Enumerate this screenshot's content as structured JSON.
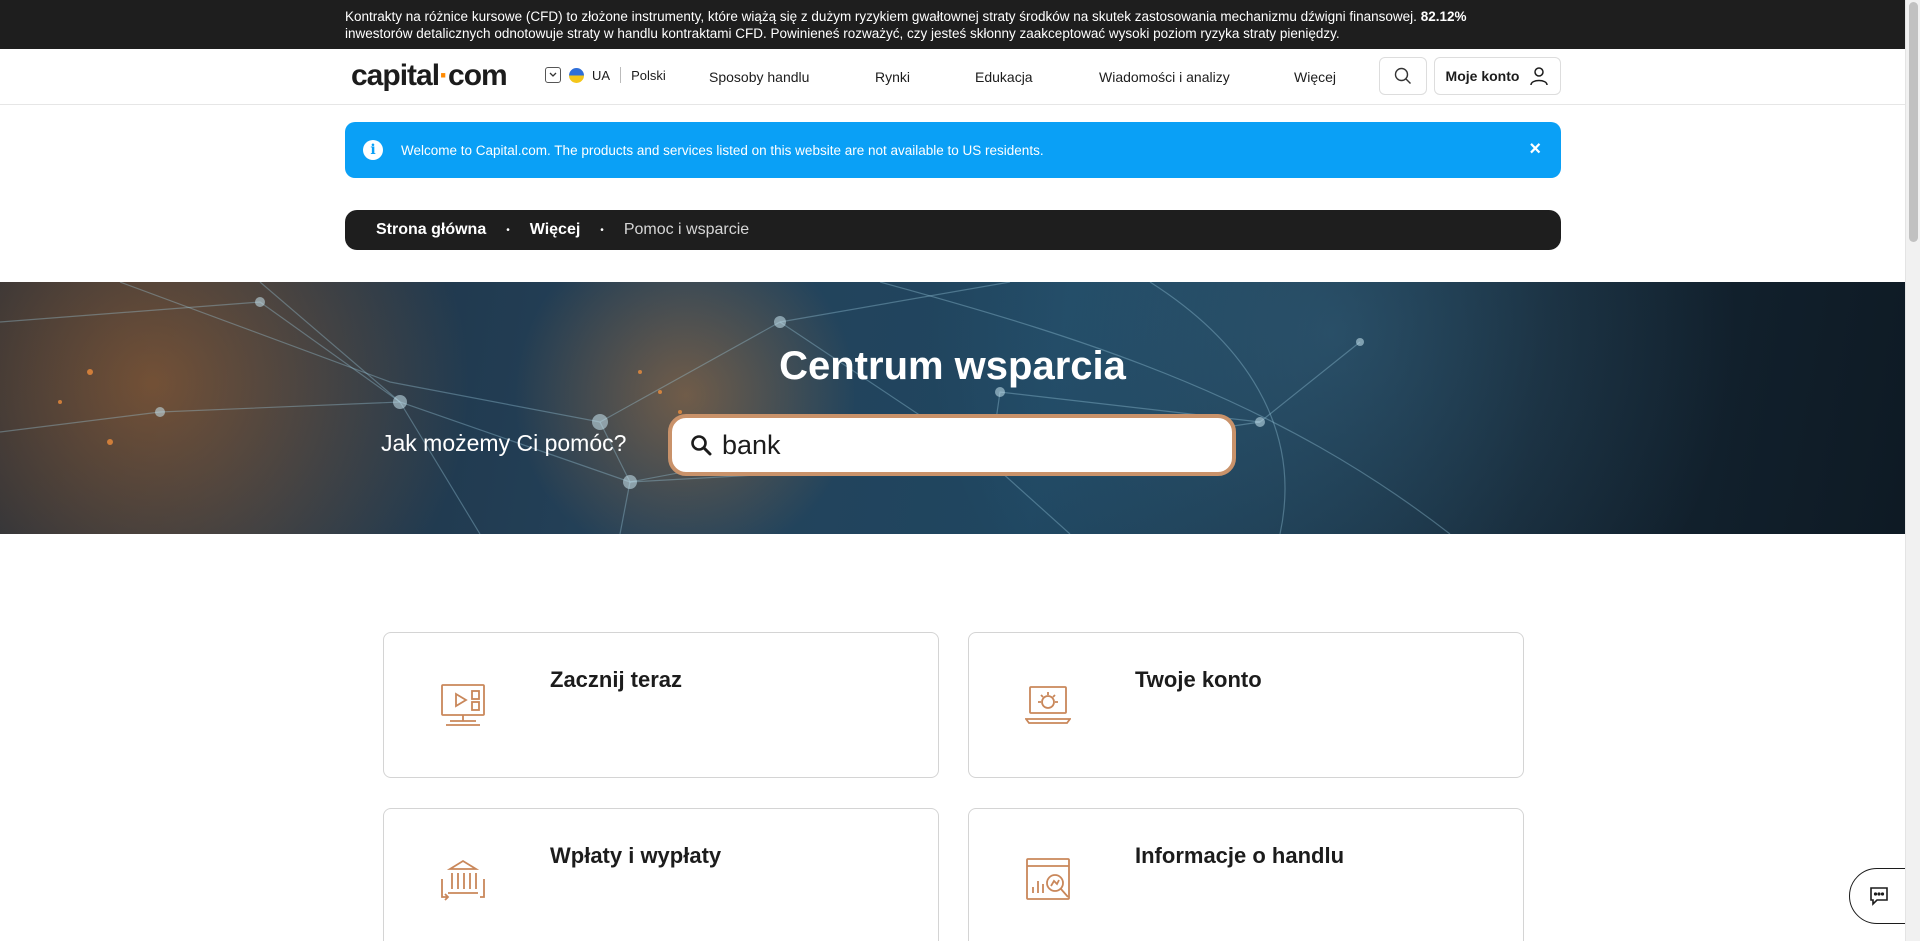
{
  "risk_banner": {
    "text": "Kontrakty na różnice kursowe (CFD) to złożone instrumenty, które wiążą się z dużym ryzykiem gwałtownej straty środków na skutek zastosowania mechanizmu dźwigni finansowej.",
    "percent": "82.12%",
    "text2": "inwestorów detalicznych odnotowuje straty w handlu kontraktami CFD. Powinieneś rozważyć, czy jesteś skłonny zaakceptować wysoki poziom ryzyka straty pieniędzy."
  },
  "header": {
    "logo_left": "capital",
    "logo_dot": "·",
    "logo_right": "com",
    "region_code": "UA",
    "language": "Polski",
    "nav": [
      "Sposoby handlu",
      "Rynki",
      "Edukacja",
      "Wiadomości i analizy",
      "Więcej"
    ],
    "account_label": "Moje konto"
  },
  "info_banner": {
    "text": "Welcome to Capital.com. The products and services listed on this website are not available to US residents.",
    "close": "×"
  },
  "breadcrumb": {
    "items": [
      "Strona główna",
      "Więcej",
      "Pomoc i wsparcie"
    ],
    "separator": "•"
  },
  "hero": {
    "title": "Centrum wsparcia",
    "prompt": "Jak możemy Ci pomóc?",
    "search_value": "bank"
  },
  "cards": [
    {
      "title": "Zacznij teraz",
      "icon": "video-screen-icon"
    },
    {
      "title": "Twoje konto",
      "icon": "laptop-gear-icon"
    },
    {
      "title": "Wpłaty i wypłaty",
      "icon": "bank-transfer-icon"
    },
    {
      "title": "Informacje o handlu",
      "icon": "chart-magnifier-icon"
    }
  ],
  "colors": {
    "accent": "#ff8a00",
    "info_blue": "#0aa0f6",
    "dark": "#1e1e1e",
    "icon_orange": "#c9875a"
  }
}
